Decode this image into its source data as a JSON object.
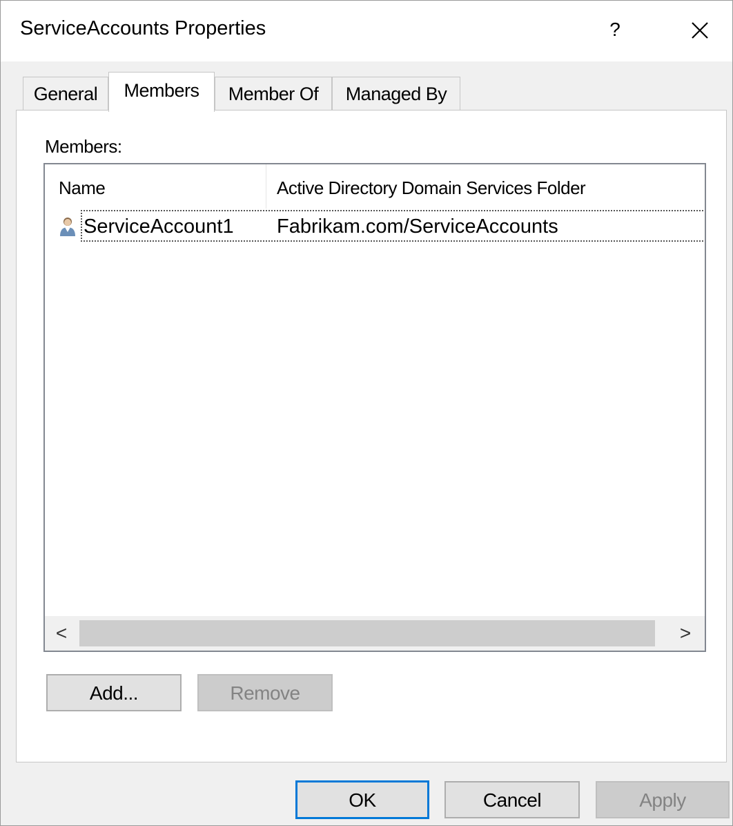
{
  "window": {
    "title": "ServiceAccounts Properties",
    "help_label": "?"
  },
  "tabs": [
    {
      "label": "General",
      "active": false
    },
    {
      "label": "Members",
      "active": true
    },
    {
      "label": "Member Of",
      "active": false
    },
    {
      "label": "Managed By",
      "active": false
    }
  ],
  "members": {
    "label": "Members:",
    "columns": [
      "Name",
      "Active Directory Domain Services Folder"
    ],
    "rows": [
      {
        "name": "ServiceAccount1",
        "folder": "Fabrikam.com/ServiceAccounts",
        "icon": "user-icon"
      }
    ],
    "scroll_left": "<",
    "scroll_right": ">"
  },
  "buttons": {
    "add": "Add...",
    "remove": "Remove",
    "ok": "OK",
    "cancel": "Cancel",
    "apply": "Apply"
  },
  "colors": {
    "focus_border": "#0078d7",
    "disabled_text": "#838383"
  }
}
